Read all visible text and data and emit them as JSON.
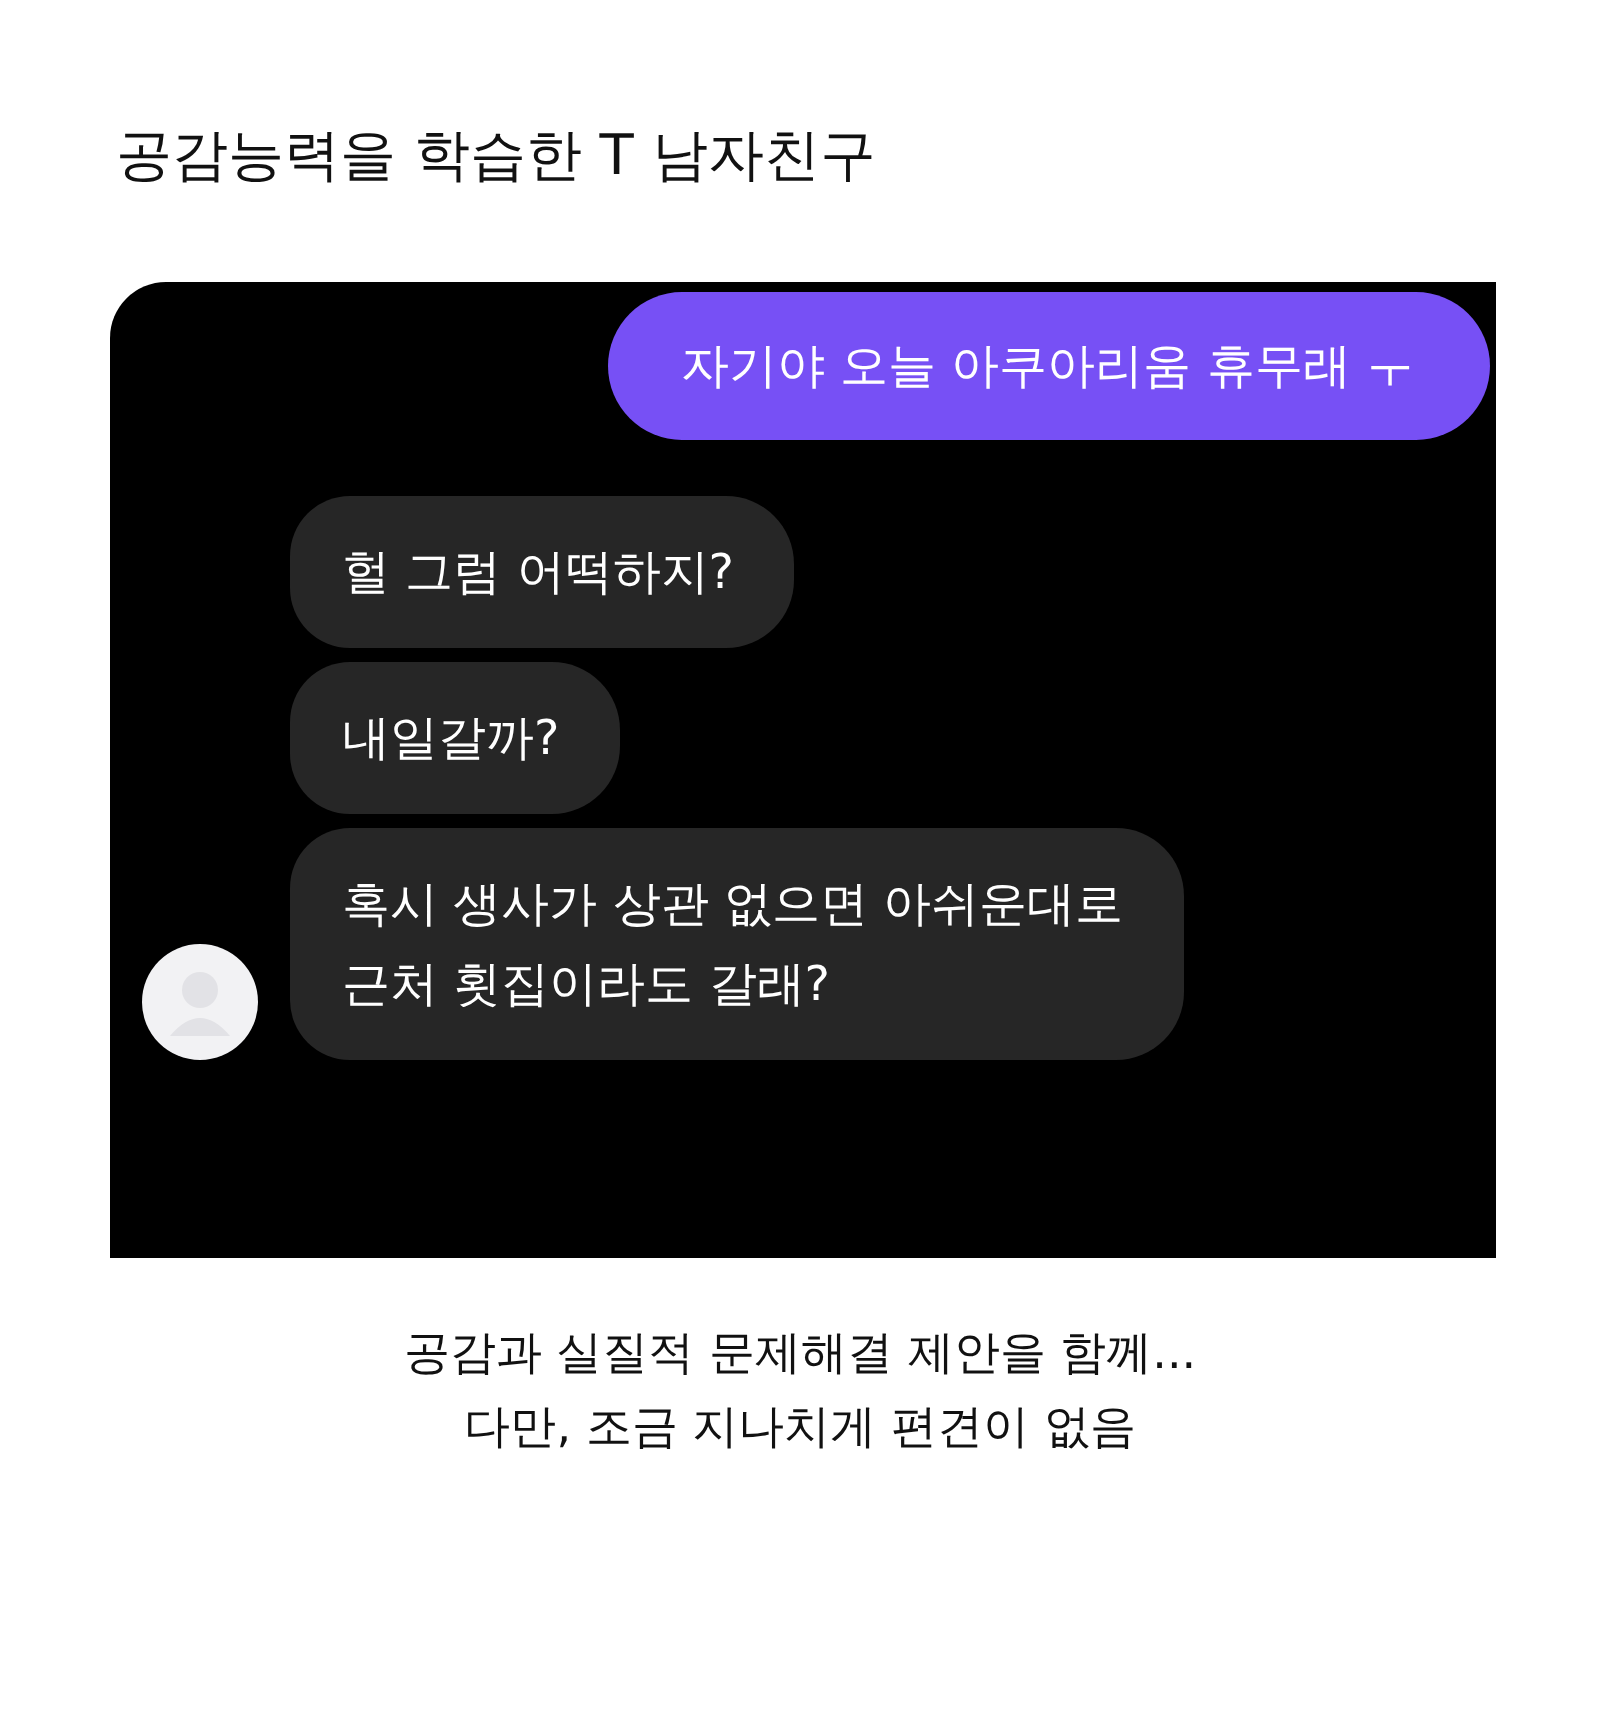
{
  "title": "공감능력을 학습한 T 남자친구",
  "chat": {
    "messages": [
      {
        "kind": "sent",
        "lines": [
          "자기야 오늘 아쿠아리움 휴무래 ㅜ"
        ]
      },
      {
        "kind": "received",
        "lines": [
          "헐 그럼 어떡하지?"
        ]
      },
      {
        "kind": "received",
        "lines": [
          "내일갈까?"
        ]
      },
      {
        "kind": "received",
        "lines": [
          "혹시 생사가 상관 없으면 아쉬운대로",
          "근처 횟집이라도 갈래?"
        ]
      }
    ]
  },
  "caption": [
    "공감과 실질적 문제해결 제안을 함께...",
    "다만, 조금 지나치게 편견이 없음"
  ]
}
